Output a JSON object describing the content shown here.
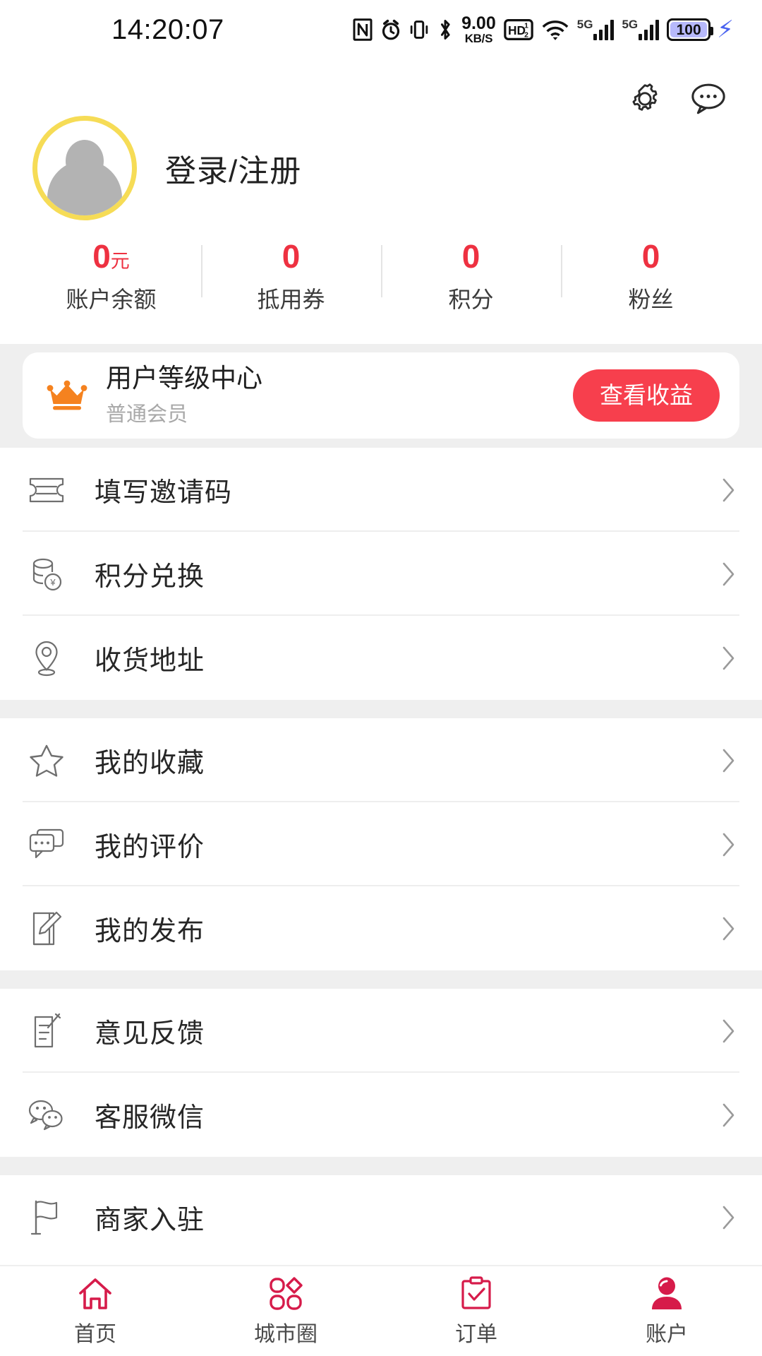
{
  "statusbar": {
    "time": "14:20:07",
    "net_speed_value": "9.00",
    "net_speed_unit": "KB/S",
    "hd_label": "HD",
    "hd_sup": "1",
    "hd_sub": "2",
    "sim1_label": "5G",
    "sim2_label": "5G",
    "battery_percent": "100",
    "icons": [
      "nfc-icon",
      "alarm-icon",
      "vibrate-icon",
      "bluetooth-icon",
      "wifi-icon",
      "charging-bolt-icon"
    ]
  },
  "header": {
    "settings_icon": "gear-icon",
    "message_icon": "chat-bubble-icon",
    "avatar_icon": "default-avatar-icon",
    "login_label": "登录/注册"
  },
  "stats": [
    {
      "value": "0",
      "unit": "元",
      "label": "账户余额"
    },
    {
      "value": "0",
      "unit": "",
      "label": "抵用券"
    },
    {
      "value": "0",
      "unit": "",
      "label": "积分"
    },
    {
      "value": "0",
      "unit": "",
      "label": "粉丝"
    }
  ],
  "member_card": {
    "icon": "crown-icon",
    "title": "用户等级中心",
    "subtitle": "普通会员",
    "button_label": "查看收益"
  },
  "menu_groups": [
    {
      "items": [
        {
          "icon": "ticket-icon",
          "label": "填写邀请码"
        },
        {
          "icon": "coins-icon",
          "label": "积分兑换"
        },
        {
          "icon": "location-pin-icon",
          "label": "收货地址"
        }
      ]
    },
    {
      "items": [
        {
          "icon": "star-icon",
          "label": "我的收藏"
        },
        {
          "icon": "comment-icon",
          "label": "我的评价"
        },
        {
          "icon": "edit-note-icon",
          "label": "我的发布"
        }
      ]
    },
    {
      "items": [
        {
          "icon": "feedback-icon",
          "label": "意见反馈"
        },
        {
          "icon": "wechat-icon",
          "label": "客服微信"
        }
      ]
    },
    {
      "items": [
        {
          "icon": "flag-icon",
          "label": "商家入驻"
        }
      ]
    }
  ],
  "tabbar": [
    {
      "icon": "home-icon",
      "label": "首页",
      "active": false
    },
    {
      "icon": "petals-icon",
      "label": "城市圈",
      "active": false
    },
    {
      "icon": "clipboard-check-icon",
      "label": "订单",
      "active": false
    },
    {
      "icon": "person-filled-icon",
      "label": "账户",
      "active": true
    }
  ],
  "colors": {
    "accent_red": "#EE3141",
    "button_red": "#F73F4D",
    "crown_orange": "#F5821F",
    "avatar_ring_yellow": "#F6DC56",
    "tab_crimson": "#D61B4A",
    "band_gray": "#EFEFEF"
  }
}
